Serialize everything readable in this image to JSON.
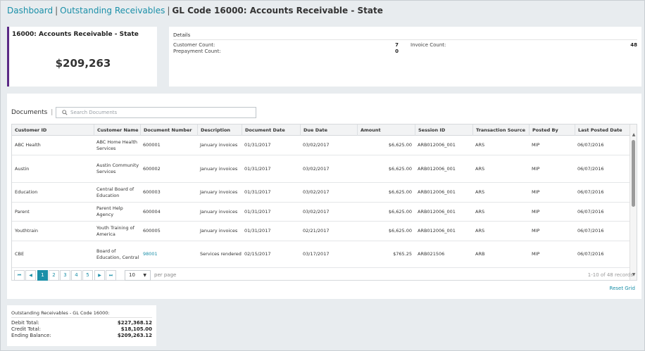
{
  "breadcrumb": {
    "dashboard": "Dashboard",
    "outstanding": "Outstanding Receivables",
    "current": "GL Code 16000: Accounts Receivable - State",
    "separator": "|"
  },
  "summary": {
    "title": "16000: Accounts Receivable - State",
    "amount": "$209,263"
  },
  "details": {
    "title": "Details",
    "customer_count_label": "Customer Count:",
    "customer_count": "7",
    "prepayment_count_label": "Prepayment Count:",
    "prepayment_count": "0",
    "invoice_count_label": "Invoice Count:",
    "invoice_count": "48"
  },
  "documents": {
    "title": "Documents",
    "separator": "|",
    "search_placeholder": "Search Documents",
    "columns": [
      "Customer ID",
      "Customer Name",
      "Document Number",
      "Description",
      "Document Date",
      "Due Date",
      "Amount",
      "Session ID",
      "Transaction Source",
      "Posted By",
      "Last Posted Date"
    ],
    "rows": [
      {
        "customer_id": "ABC Health",
        "customer_name": "ABC Home Health Services",
        "document_number": "600001",
        "description": "January invoices",
        "document_date": "01/31/2017",
        "due_date": "03/02/2017",
        "amount": "$6,625.00",
        "session_id": "ARB012006_001",
        "transaction_source": "ARS",
        "posted_by": "MIP",
        "last_posted_date": "06/07/2016"
      },
      {
        "customer_id": "Austin",
        "customer_name": "Austin Community Services",
        "document_number": "600002",
        "description": "January invoices",
        "document_date": "01/31/2017",
        "due_date": "03/02/2017",
        "amount": "$6,625.00",
        "session_id": "ARB012006_001",
        "transaction_source": "ARS",
        "posted_by": "MIP",
        "last_posted_date": "06/07/2016"
      },
      {
        "customer_id": "Education",
        "customer_name": "Central Board of Education",
        "document_number": "600003",
        "description": "January invoices",
        "document_date": "01/31/2017",
        "due_date": "03/02/2017",
        "amount": "$6,625.00",
        "session_id": "ARB012006_001",
        "transaction_source": "ARS",
        "posted_by": "MIP",
        "last_posted_date": "06/07/2016"
      },
      {
        "customer_id": "Parent",
        "customer_name": "Parent Help Agency",
        "document_number": "600004",
        "description": "January invoices",
        "document_date": "01/31/2017",
        "due_date": "03/02/2017",
        "amount": "$6,625.00",
        "session_id": "ARB012006_001",
        "transaction_source": "ARS",
        "posted_by": "MIP",
        "last_posted_date": "06/07/2016"
      },
      {
        "customer_id": "Youthtrain",
        "customer_name": "Youth Training of America",
        "document_number": "600005",
        "description": "January invoices",
        "document_date": "01/31/2017",
        "due_date": "02/21/2017",
        "amount": "$6,625.00",
        "session_id": "ARB012006_001",
        "transaction_source": "ARS",
        "posted_by": "MIP",
        "last_posted_date": "06/07/2016"
      },
      {
        "customer_id": "CBE",
        "customer_name": "Board of Education, Central",
        "document_number": "98001",
        "description": "Services rendered",
        "document_date": "02/15/2017",
        "due_date": "03/17/2017",
        "amount": "$765.25",
        "session_id": "ARB021506",
        "transaction_source": "ARB",
        "posted_by": "MIP",
        "last_posted_date": "06/07/2016"
      }
    ]
  },
  "pager": {
    "first": "⏮",
    "prev": "◀",
    "pages": [
      "1",
      "2",
      "3",
      "4",
      "5"
    ],
    "active_page": "1",
    "next": "▶",
    "last": "⏭",
    "per_page_value": "10",
    "per_page_label": "per page",
    "records": "1-10 of 48 records",
    "reset_grid": "Reset Grid"
  },
  "totals": {
    "title": "Outstanding Receivables - GL Code 16000:",
    "debit_label": "Debit Total:",
    "debit_value": "$227,368.12",
    "credit_label": "Credit Total:",
    "credit_value": "$18,105.00",
    "ending_label": "Ending Balance:",
    "ending_value": "$209,263.12"
  },
  "colors": {
    "accent": "#1a8fa8",
    "summary_border": "#5b2a86",
    "background": "#e8ecef"
  }
}
